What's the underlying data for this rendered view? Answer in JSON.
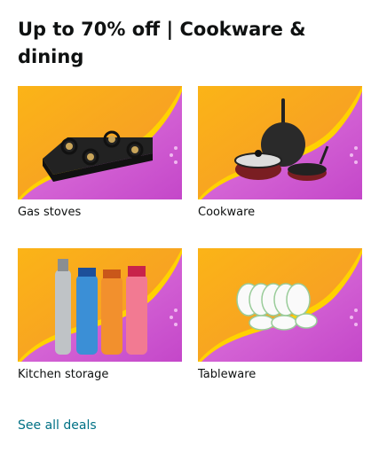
{
  "title": "Up to 70% off | Cookware & dining",
  "cards": [
    {
      "label": "Gas stoves",
      "icon": "gas-stove-image"
    },
    {
      "label": "Cookware",
      "icon": "cookware-image"
    },
    {
      "label": "Kitchen storage",
      "icon": "bottles-image"
    },
    {
      "label": "Tableware",
      "icon": "tableware-image"
    }
  ],
  "see_all": "See all deals",
  "colors": {
    "orange": "#f7a61f",
    "pink": "#d95fd6",
    "link": "#007185"
  }
}
